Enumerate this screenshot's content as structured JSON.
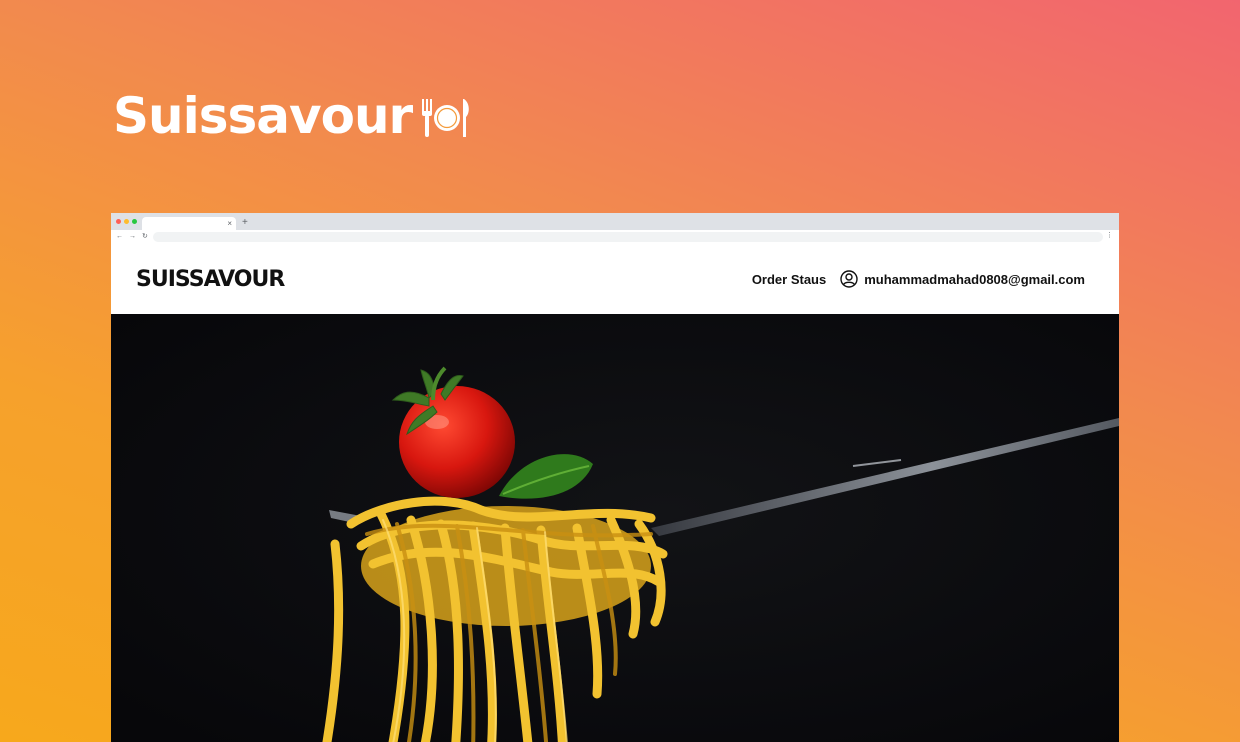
{
  "showcase": {
    "brand_name": "Suissavour",
    "brand_icon": "plate-cutlery-icon"
  },
  "browser": {
    "traffic_lights": [
      "#ff5f57",
      "#febc2e",
      "#28c840"
    ],
    "tab_close": "×",
    "new_tab": "+"
  },
  "site": {
    "logo": "SUISSAVOUR",
    "nav": {
      "order_status": "Order Staus",
      "user_icon": "user-circle-icon",
      "email": "muhammadmahad0808@gmail.com"
    },
    "hero": {
      "image": "spaghetti-on-fork-with-tomato-and-basil"
    }
  },
  "colors": {
    "gradient_top": "#f2656f",
    "gradient_bottom": "#f7a81c",
    "hero_bg": "#0b0b0d"
  }
}
